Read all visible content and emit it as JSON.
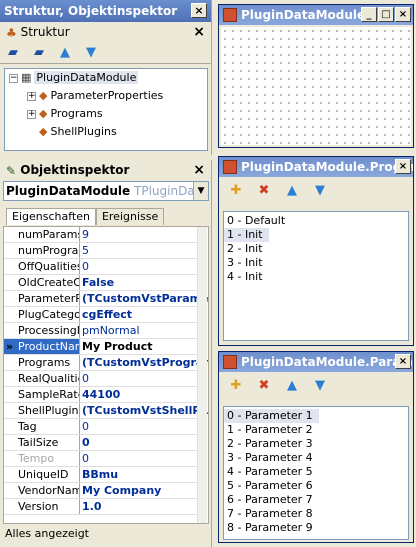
{
  "struktur": {
    "title": "Struktur, Objektinspektor",
    "header": "Struktur",
    "tree": [
      {
        "label": "PluginDataModule",
        "expander": "−",
        "selected": true
      },
      {
        "label": "ParameterProperties",
        "expander": "+"
      },
      {
        "label": "Programs",
        "expander": "+"
      },
      {
        "label": "ShellPlugins",
        "expander": ""
      }
    ]
  },
  "inspector": {
    "header": "Objektinspektor",
    "object_name": "PluginDataModule",
    "object_type": "TPluginDataMod",
    "tabs": [
      "Eigenschaften",
      "Ereignisse"
    ],
    "properties": [
      {
        "name": "numParams",
        "value": "9",
        "bold": false
      },
      {
        "name": "numPrograms",
        "value": "5",
        "bold": false
      },
      {
        "name": "OffQualities",
        "value": "0",
        "bold": false
      },
      {
        "name": "OldCreateOrder",
        "value": "False",
        "bold": true
      },
      {
        "name": "ParameterProperties",
        "value": "(TCustomVstParameterProperties)",
        "bold": true
      },
      {
        "name": "PlugCategory",
        "value": "cgEffect",
        "bold": true
      },
      {
        "name": "ProcessingMode",
        "value": "pmNormal",
        "bold": false
      },
      {
        "name": "ProductName",
        "value": "My Product",
        "bold": true,
        "selected": true
      },
      {
        "name": "Programs",
        "value": "(TCustomVstPrograms)",
        "bold": true
      },
      {
        "name": "RealQualities",
        "value": "0",
        "bold": false
      },
      {
        "name": "SampleRate",
        "value": "44100",
        "bold": true
      },
      {
        "name": "ShellPlugins",
        "value": "(TCustomVstShellPlugins)",
        "bold": true
      },
      {
        "name": "Tag",
        "value": "0",
        "bold": false
      },
      {
        "name": "TailSize",
        "value": "0",
        "bold": true
      },
      {
        "name": "Tempo",
        "value": "0",
        "bold": false,
        "gray": true
      },
      {
        "name": "UniqueID",
        "value": "BBmu",
        "bold": true
      },
      {
        "name": "VendorName",
        "value": "My Company",
        "bold": true
      },
      {
        "name": "Version",
        "value": "1.0",
        "bold": true
      }
    ],
    "status": "Alles angezeigt"
  },
  "designer": {
    "title": "PluginDataModule"
  },
  "programs_window": {
    "title": "PluginDataModule.Programs",
    "items": [
      "0 - Default",
      "1 - Init",
      "2 - Init",
      "3 - Init",
      "4 - Init"
    ],
    "selected_index": 1
  },
  "params_window": {
    "title": "PluginDataModule.ParameterProperties",
    "items": [
      "0 - Parameter 1",
      "1 - Parameter 2",
      "2 - Parameter 3",
      "3 - Parameter 4",
      "4 - Parameter 5",
      "5 - Parameter 6",
      "6 - Parameter 7",
      "7 - Parameter 8",
      "8 - Parameter 9"
    ],
    "selected_index": 0
  },
  "buttons": {
    "close": "×",
    "minimize": "_",
    "maximize": "□",
    "dropdown": "▼",
    "selector": "»"
  }
}
